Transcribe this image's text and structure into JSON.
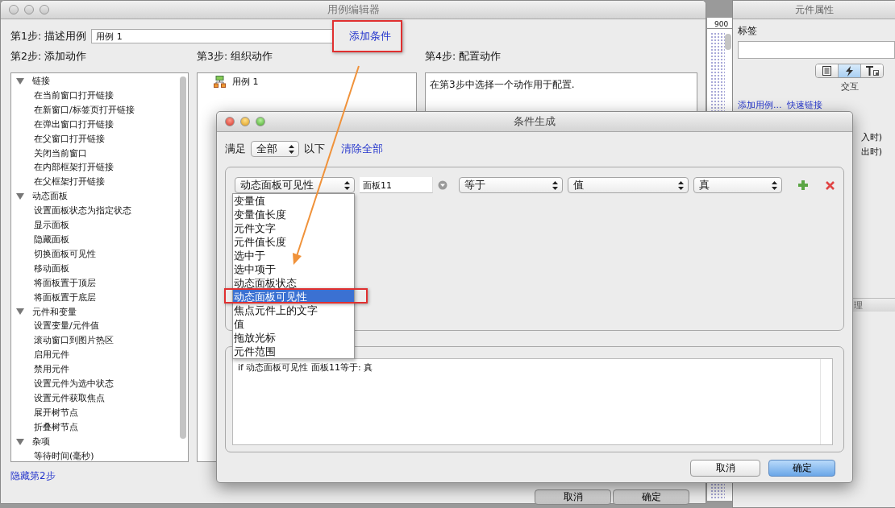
{
  "editor_window": {
    "title": "用例编辑器",
    "step1_label": "第1步: 描述用例",
    "case_name": "用例 1",
    "add_condition_link": "添加条件",
    "step2_label": "第2步: 添加动作",
    "step3_label": "第3步: 组织动作",
    "step4_label": "第4步: 配置动作",
    "action_tree": [
      {
        "label": "链接",
        "expanded": true,
        "children": [
          {
            "label": "在当前窗口打开链接"
          },
          {
            "label": "在新窗口/标签页打开链接"
          },
          {
            "label": "在弹出窗口打开链接"
          },
          {
            "label": "在父窗口打开链接"
          },
          {
            "label": "关闭当前窗口"
          },
          {
            "label": "在内部框架打开链接"
          },
          {
            "label": "在父框架打开链接"
          }
        ]
      },
      {
        "label": "动态面板",
        "expanded": true,
        "children": [
          {
            "label": "设置面板状态为指定状态"
          },
          {
            "label": "显示面板"
          },
          {
            "label": "隐藏面板"
          },
          {
            "label": "切换面板可见性"
          },
          {
            "label": "移动面板"
          },
          {
            "label": "将面板置于顶层"
          },
          {
            "label": "将面板置于底层"
          }
        ]
      },
      {
        "label": "元件和变量",
        "expanded": true,
        "children": [
          {
            "label": "设置变量/元件值"
          },
          {
            "label": "滚动窗口到图片热区"
          },
          {
            "label": "启用元件"
          },
          {
            "label": "禁用元件"
          },
          {
            "label": "设置元件为选中状态"
          },
          {
            "label": "设置元件获取焦点"
          },
          {
            "label": "展开树节点"
          },
          {
            "label": "折叠树节点"
          }
        ]
      },
      {
        "label": "杂项",
        "expanded": true,
        "children": [
          {
            "label": "等待时间(毫秒)"
          }
        ]
      }
    ],
    "organize_tree": [
      {
        "label": "用例 1"
      }
    ],
    "config_hint": "在第3步中选择一个动作用于配置.",
    "hide_step2_link": "隐藏第2步",
    "buttons": [
      "取消",
      "确定"
    ]
  },
  "ruler": {
    "label": "900"
  },
  "properties_panel": {
    "title": "元件属性",
    "label_caption": "标签",
    "tabs": [
      {
        "kind": "document",
        "selected": false
      },
      {
        "kind": "lightning",
        "selected": true
      },
      {
        "kind": "text-style",
        "selected": false
      }
    ],
    "tab_caption": "交互",
    "links": [
      "添加用例...",
      "快速链接"
    ],
    "covered_texts": [
      "入时)",
      "出时)"
    ],
    "section_title": "理"
  },
  "condition_dialog": {
    "title": "条件生成",
    "match_label": "满足",
    "match_select": "全部",
    "match_suffix": "以下",
    "clear_all_link": "清除全部",
    "conditions": [
      {
        "type": "动态面板可见性",
        "target": "面板11",
        "operator": "等于",
        "value_kind": "值",
        "value": "真"
      }
    ],
    "dropdown": {
      "items": [
        {
          "label": "变量值",
          "selected": false
        },
        {
          "label": "变量值长度",
          "selected": false
        },
        {
          "label": "元件文字",
          "selected": false
        },
        {
          "label": "元件值长度",
          "selected": false
        },
        {
          "label": "选中于",
          "selected": false
        },
        {
          "label": "选中项于",
          "selected": false
        },
        {
          "label": "动态面板状态",
          "selected": false
        },
        {
          "label": "动态面板可见性",
          "selected": true
        },
        {
          "label": "焦点元件上的文字",
          "selected": false
        },
        {
          "label": "值",
          "selected": false
        },
        {
          "label": "拖放光标",
          "selected": false
        },
        {
          "label": "元件范围",
          "selected": false
        }
      ]
    },
    "description": "if 动态面板可见性 面板11等于: 真",
    "buttons": [
      {
        "label": "取消",
        "default": false
      },
      {
        "label": "确定",
        "default": true
      }
    ]
  }
}
